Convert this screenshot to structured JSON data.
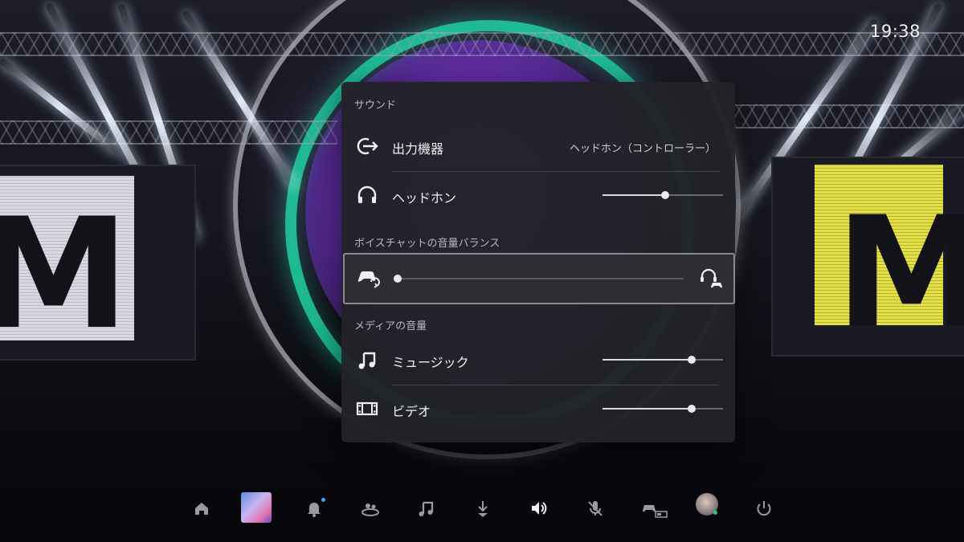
{
  "clock": {
    "time": "19:38"
  },
  "sound_panel": {
    "title": "サウンド",
    "output_device": {
      "label": "出力機器",
      "value": "ヘッドホン（コントローラー）",
      "icon": "output-arrow-icon"
    },
    "headphone": {
      "label": "ヘッドホン",
      "icon": "headphones-icon",
      "volume_fraction": 0.52
    },
    "voice_chat_balance": {
      "section_label": "ボイスチャットの音量バランス",
      "left_icon": "controller-chat-icon",
      "right_icon": "headset-game-icon",
      "balance_fraction": 0.0
    },
    "media_volume": {
      "section_label": "メディアの音量",
      "music": {
        "label": "ミュージック",
        "icon": "music-note-icon",
        "volume_fraction": 0.74
      },
      "video": {
        "label": "ビデオ",
        "icon": "film-icon",
        "volume_fraction": 0.74
      }
    }
  },
  "control_center": {
    "items": [
      {
        "name": "home-icon",
        "active": false
      },
      {
        "name": "game-thumbnail",
        "active": false
      },
      {
        "name": "notifications-bell-icon",
        "active": false,
        "badge": true
      },
      {
        "name": "game-base-icon",
        "active": false
      },
      {
        "name": "music-icon",
        "active": false
      },
      {
        "name": "download-icon",
        "active": false
      },
      {
        "name": "speaker-volume-icon",
        "active": true
      },
      {
        "name": "mic-muted-icon",
        "active": false
      },
      {
        "name": "controller-battery-icon",
        "active": false
      },
      {
        "name": "user-avatar",
        "active": false,
        "online": true
      },
      {
        "name": "power-icon",
        "active": false
      }
    ]
  },
  "colors": {
    "panel_bg": "#222228",
    "accent_ring": "#1fd6a6",
    "online_dot": "#2ecc71",
    "badge_dot": "#3ea6ff"
  }
}
